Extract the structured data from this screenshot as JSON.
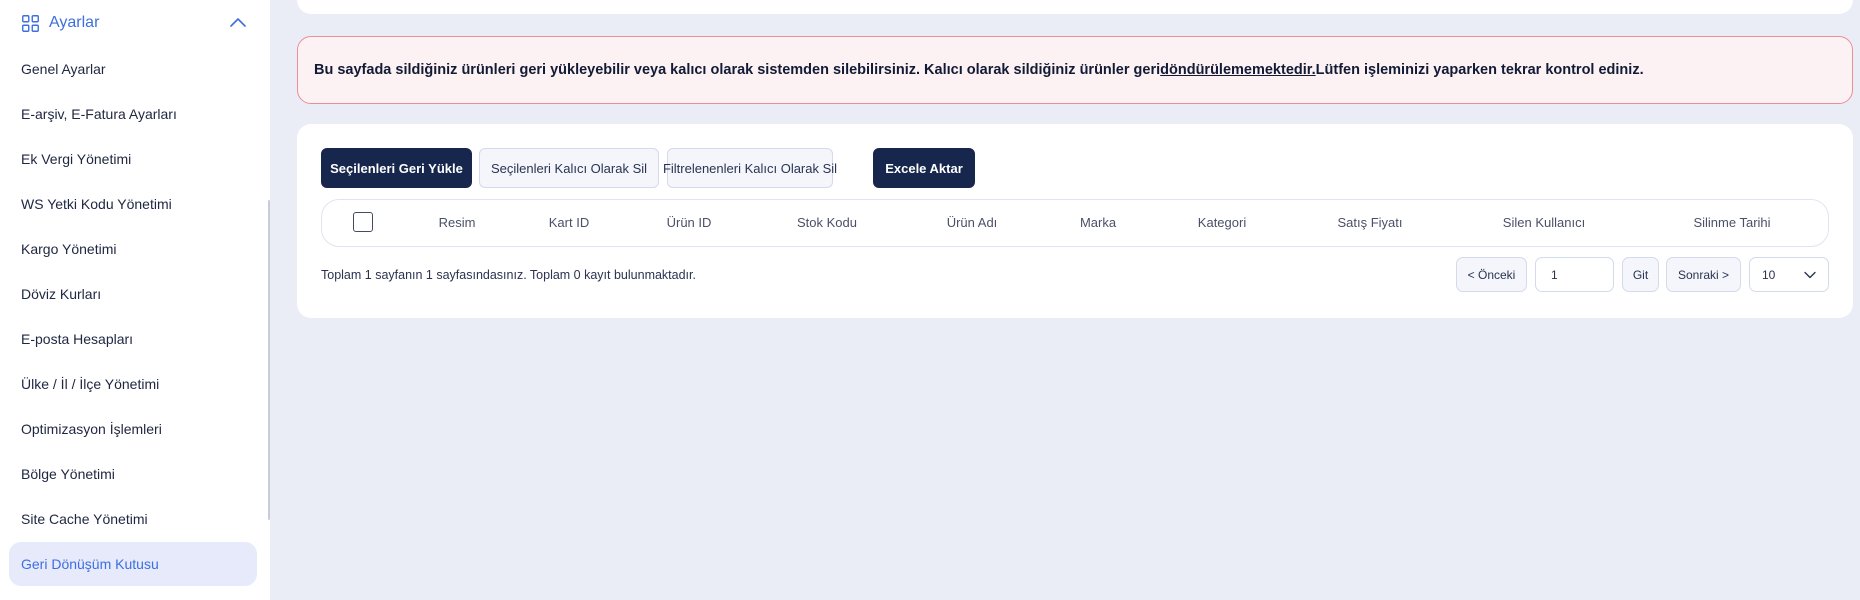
{
  "sidebar": {
    "section_label": "Ayarlar",
    "items": [
      {
        "label": "Genel Ayarlar"
      },
      {
        "label": "E-arşiv, E-Fatura Ayarları"
      },
      {
        "label": "Ek Vergi Yönetimi"
      },
      {
        "label": "WS Yetki Kodu Yönetimi"
      },
      {
        "label": "Kargo Yönetimi"
      },
      {
        "label": "Döviz Kurları"
      },
      {
        "label": "E-posta Hesapları"
      },
      {
        "label": "Ülke / İl / İlçe Yönetimi"
      },
      {
        "label": "Optimizasyon İşlemleri"
      },
      {
        "label": "Bölge Yönetimi"
      },
      {
        "label": "Site Cache Yönetimi"
      },
      {
        "label": "Geri Dönüşüm Kutusu",
        "active": true
      }
    ]
  },
  "alert": {
    "text_before": "Bu sayfada sildiğiniz ürünleri geri yükleyebilir veya kalıcı olarak sistemden silebilirsiniz. Kalıcı olarak sildiğiniz ürünler geri ",
    "underlined": "döndürülememektedir.",
    "text_after": " Lütfen işleminizi yaparken tekrar kontrol ediniz."
  },
  "toolbar": {
    "restore_selected": "Seçilenleri Geri Yükle",
    "delete_selected": "Seçilenleri Kalıcı Olarak Sil",
    "delete_filtered": "Filtrelenenleri Kalıcı Olarak Sil",
    "export_excel": "Excele Aktar"
  },
  "table": {
    "columns": [
      "Resim",
      "Kart ID",
      "Ürün ID",
      "Stok Kodu",
      "Ürün Adı",
      "Marka",
      "Kategori",
      "Satış Fiyatı",
      "Silen Kullanıcı",
      "Silinme Tarihi"
    ],
    "rows": []
  },
  "pagination": {
    "summary": "Toplam 1 sayfanın 1 sayfasındasınız. Toplam 0 kayıt bulunmaktadır.",
    "prev_label": "< Önceki",
    "page_value": "1",
    "go_label": "Git",
    "next_label": "Sonraki >",
    "page_size": "10"
  },
  "colors": {
    "accent": "#3d6fe0",
    "dark_button": "#17264c",
    "alert_border": "#ec8e98",
    "alert_bg": "#fcf2f3",
    "page_bg": "#eaedf5"
  }
}
